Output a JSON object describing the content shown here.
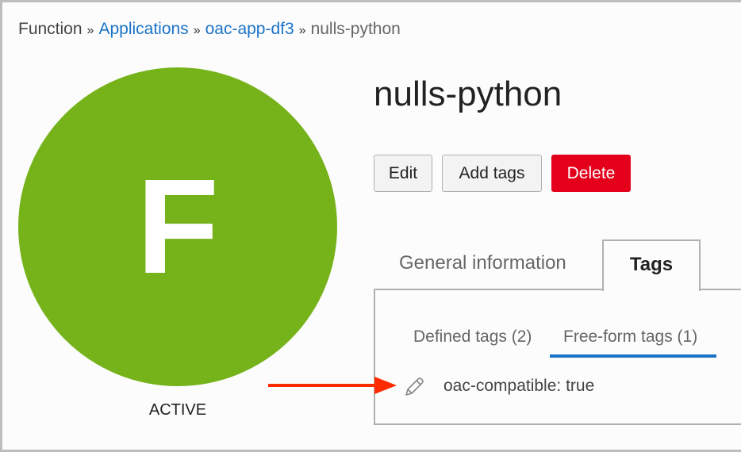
{
  "breadcrumb": {
    "items": [
      "Function",
      "Applications",
      "oac-app-df3",
      "nulls-python"
    ],
    "separator": "»"
  },
  "resource": {
    "initial": "F",
    "status": "ACTIVE",
    "title": "nulls-python",
    "color": "#76b31b"
  },
  "actions": {
    "edit": "Edit",
    "add_tags": "Add tags",
    "delete": "Delete"
  },
  "tabs": {
    "general": "General information",
    "tags": "Tags",
    "active": "Tags"
  },
  "subtabs": {
    "defined": "Defined tags (2)",
    "freeform": "Free-form tags (1)",
    "active": "Free-form tags (1)"
  },
  "tags": [
    {
      "text": "oac-compatible: true",
      "icon": "pencil-icon"
    }
  ],
  "colors": {
    "link": "#1a73c8",
    "delete": "#e4001b",
    "arrow": "#ff2a00"
  }
}
